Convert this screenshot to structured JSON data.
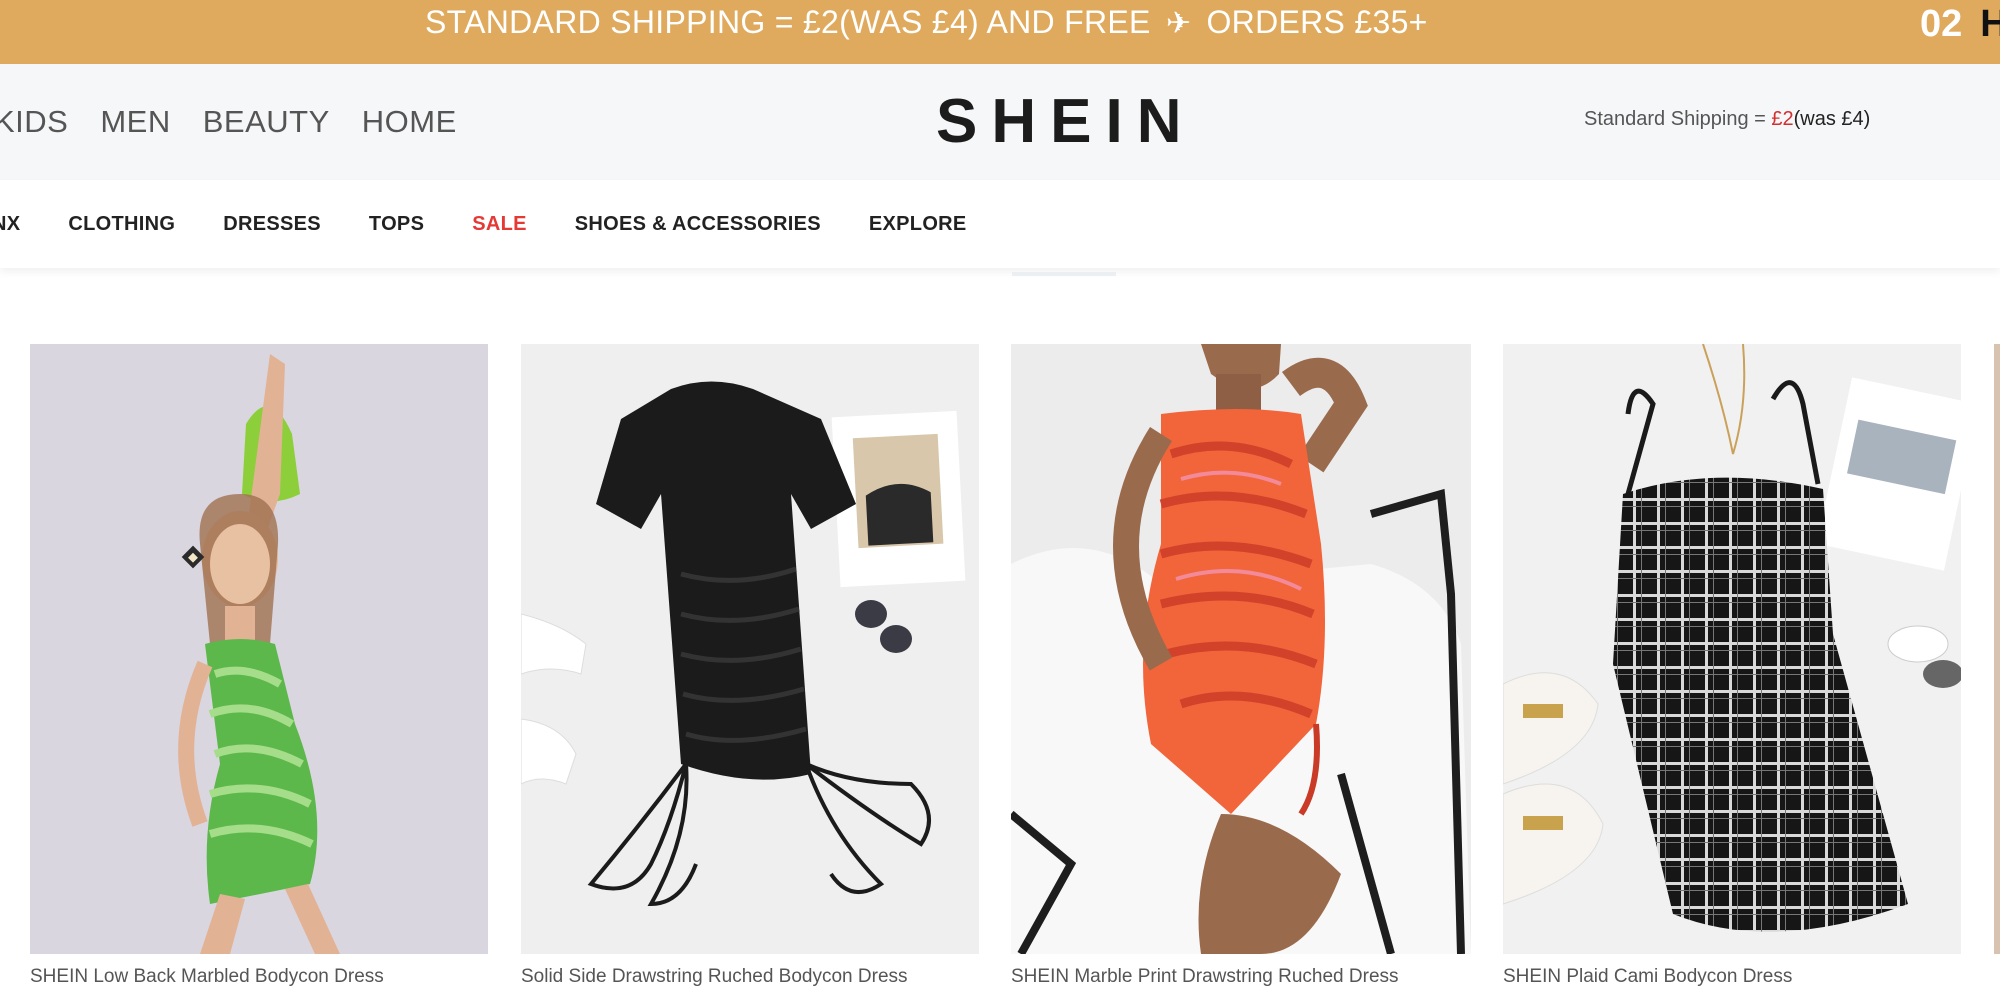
{
  "promo": {
    "text_before": "STANDARD SHIPPING = £2(WAS £4) AND FREE",
    "icon": "airplane-icon",
    "text_after": "ORDERS £35+",
    "countdown": "02",
    "countdown_next": "H"
  },
  "header": {
    "categories": [
      "KIDS",
      "MEN",
      "BEAUTY",
      "HOME"
    ],
    "logo": "SHEIN",
    "shipping_note": {
      "label": "Standard Shipping = ",
      "price": "£2",
      "was": "(was £4)"
    }
  },
  "subnav": {
    "items": [
      "NX",
      "CLOTHING",
      "DRESSES",
      "TOPS",
      "SALE",
      "SHOES & ACCESSORIES",
      "EXPLORE"
    ]
  },
  "products": [
    {
      "title": "SHEIN Low Back Marbled Bodycon Dress"
    },
    {
      "title": "Solid Side Drawstring Ruched Bodycon Dress"
    },
    {
      "title": "SHEIN Marble Print Drawstring Ruched Dress"
    },
    {
      "title": "SHEIN Plaid Cami Bodycon Dress"
    }
  ],
  "colors": {
    "banner": "#e0aa5e",
    "sale": "#e53935",
    "price": "#d32f2f"
  }
}
